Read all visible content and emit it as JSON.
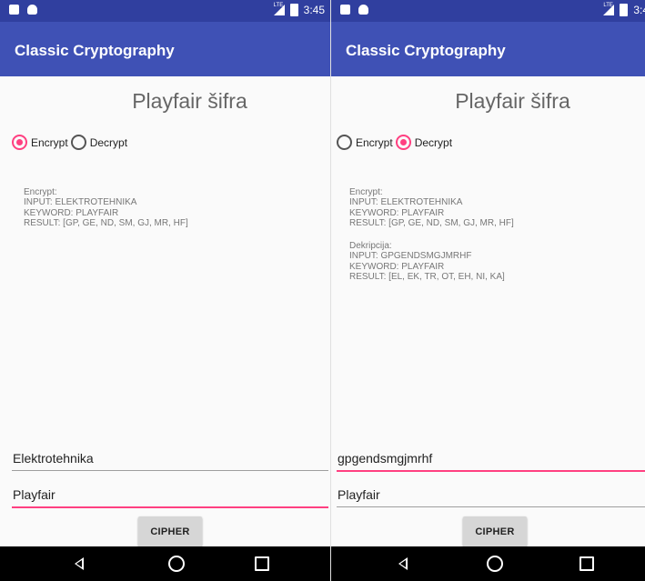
{
  "left": {
    "status": {
      "time": "3:45",
      "network": "LTE"
    },
    "app_title": "Classic Cryptography",
    "heading": "Playfair šifra",
    "radios": [
      {
        "label": "Encrypt",
        "checked": true
      },
      {
        "label": "Decrypt",
        "checked": false
      }
    ],
    "output": {
      "encrypt": {
        "title": "Encrypt:",
        "input": "INPUT: ELEKTROTEHNIKA",
        "keyword": "KEYWORD: PLAYFAIR",
        "result": "RESULT: [GP, GE, ND, SM, GJ, MR, HF]"
      }
    },
    "input_text": "Elektrotehnika",
    "keyword_text": "Playfair",
    "cipher_button": "CIPHER"
  },
  "right": {
    "status": {
      "time": "3:4",
      "network": "LTE"
    },
    "app_title": "Classic Cryptography",
    "heading": "Playfair šifra",
    "radios": [
      {
        "label": "Encrypt",
        "checked": false
      },
      {
        "label": "Decrypt",
        "checked": true
      }
    ],
    "output": {
      "encrypt": {
        "title": "Encrypt:",
        "input": "INPUT: ELEKTROTEHNIKA",
        "keyword": "KEYWORD: PLAYFAIR",
        "result": "RESULT: [GP, GE, ND, SM, GJ, MR, HF]"
      },
      "decrypt": {
        "title": "Dekripcija:",
        "input": "INPUT: GPGENDSMGJMRHF",
        "keyword": "KEYWORD: PLAYFAIR",
        "result": "RESULT: [EL, EK, TR, OT, EH, NI, KA]"
      }
    },
    "input_text": "gpgendsmgjmrhf",
    "keyword_text": "Playfair",
    "cipher_button": "CIPHER"
  },
  "colors": {
    "status_bar": "#303f9f",
    "app_bar": "#3f51b5",
    "accent": "#ff4081",
    "nav_bar": "#000000"
  },
  "icons": [
    "sd-card-icon",
    "android-icon",
    "lte-signal-icon",
    "battery-icon",
    "back-icon",
    "home-icon",
    "recents-icon"
  ]
}
